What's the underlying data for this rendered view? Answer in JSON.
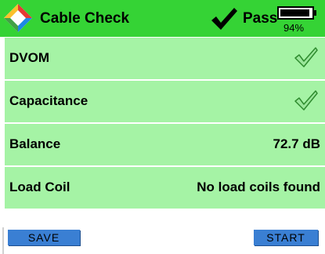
{
  "header": {
    "title": "Cable Check",
    "status": "Pass",
    "battery_percent_label": "94%",
    "battery_level": 0.94
  },
  "rows": [
    {
      "label": "DVOM",
      "value": "",
      "icon": "pass-check-icon"
    },
    {
      "label": "Capacitance",
      "value": "",
      "icon": "pass-check-icon"
    },
    {
      "label": "Balance",
      "value": "72.7 dB",
      "icon": ""
    },
    {
      "label": "Load Coil",
      "value": "No load coils found",
      "icon": ""
    }
  ],
  "footer": {
    "save_label": "SAVE",
    "start_label": "START"
  },
  "colors": {
    "header_green": "#35d335",
    "row_green": "#a5f3a5",
    "button_blue": "#3a7fd3"
  }
}
